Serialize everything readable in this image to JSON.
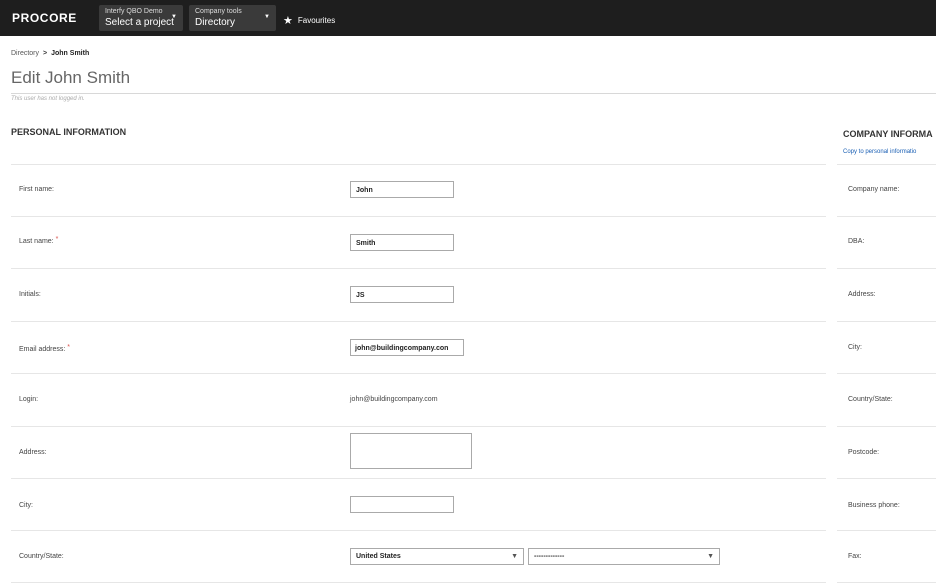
{
  "topbar": {
    "logo": "PROCORE",
    "project_picker": {
      "top": "Interfy QBO Demo",
      "bottom": "Select a project"
    },
    "tool_picker": {
      "top": "Company tools",
      "bottom": "Directory"
    },
    "favourites": "Favourites"
  },
  "breadcrumb": {
    "parent": "Directory",
    "current": "John Smith"
  },
  "page": {
    "title": "Edit John Smith",
    "login_note": "This user has not logged in."
  },
  "personal": {
    "heading": "PERSONAL INFORMATION",
    "fields": {
      "first_name": {
        "label": "First name:",
        "value": "John"
      },
      "last_name": {
        "label": "Last name:",
        "value": "Smith",
        "required": "*"
      },
      "initials": {
        "label": "Initials:",
        "value": "JS"
      },
      "email": {
        "label": "Email address:",
        "value": "john@buildingcompany.con",
        "required": "*"
      },
      "login": {
        "label": "Login:",
        "value": "john@buildingcompany.com"
      },
      "address": {
        "label": "Address:",
        "value": ""
      },
      "city": {
        "label": "City:",
        "value": ""
      },
      "country_state": {
        "label": "Country/State:",
        "country": "United States",
        "state": "-------------"
      }
    }
  },
  "company": {
    "heading": "COMPANY INFORMA",
    "copy_link": "Copy to personal informatio",
    "labels": {
      "company_name": "Company name:",
      "dba": "DBA:",
      "address": "Address:",
      "city": "City:",
      "country_state": "Country/State:",
      "postcode": "Postcode:",
      "business_phone": "Business phone:",
      "fax": "Fax:"
    }
  },
  "colors": {
    "topbar": "#1e1e1e",
    "picker": "#3a3a3a",
    "link": "#1a5fb4",
    "required": "#d9534f"
  }
}
